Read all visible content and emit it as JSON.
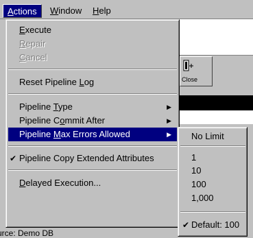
{
  "menubar": {
    "items": [
      {
        "label": "Actions",
        "active": true
      },
      {
        "label": "Window",
        "active": false
      },
      {
        "label": "Help",
        "active": false
      }
    ]
  },
  "actions_menu": {
    "execute": "Execute",
    "repair": "Repair",
    "cancel": "Cancel",
    "reset_log": "Reset Pipeline Log",
    "pipeline_type": "Pipeline Type",
    "commit_after": "Pipeline Commit After",
    "max_errors": "Pipeline Max Errors Allowed",
    "copy_attributes": "Pipeline Copy Extended Attributes",
    "delayed_execution": "Delayed Execution..."
  },
  "max_errors_submenu": {
    "no_limit": "No Limit",
    "options": [
      "1",
      "10",
      "100",
      "1,000"
    ],
    "default": "Default: 100"
  },
  "toolbar": {
    "close_label": "Close"
  },
  "status": {
    "source": "urce: Demo DB"
  },
  "colors": {
    "highlight": "#000080",
    "menu_bg": "#c0c0c0"
  }
}
